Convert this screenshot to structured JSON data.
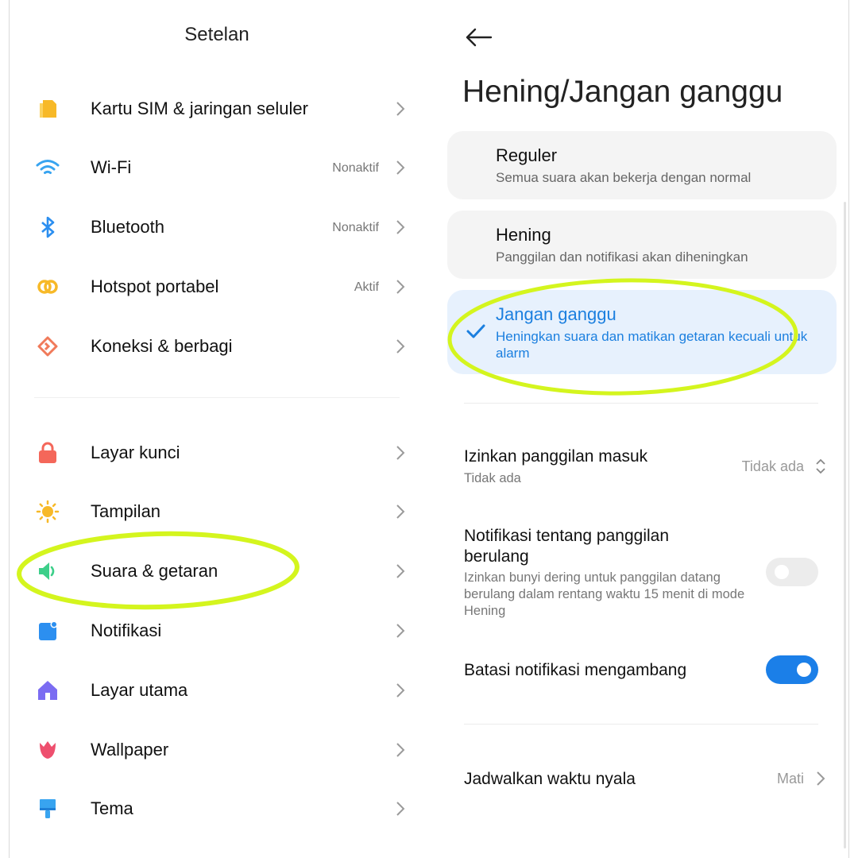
{
  "left": {
    "title": "Setelan",
    "items": [
      {
        "label": "Kartu SIM & jaringan seluler",
        "status": ""
      },
      {
        "label": "Wi-Fi",
        "status": "Nonaktif"
      },
      {
        "label": "Bluetooth",
        "status": "Nonaktif"
      },
      {
        "label": "Hotspot portabel",
        "status": "Aktif"
      },
      {
        "label": "Koneksi & berbagi",
        "status": ""
      },
      {
        "label": "Layar kunci",
        "status": ""
      },
      {
        "label": "Tampilan",
        "status": ""
      },
      {
        "label": "Suara & getaran",
        "status": ""
      },
      {
        "label": "Notifikasi",
        "status": ""
      },
      {
        "label": "Layar utama",
        "status": ""
      },
      {
        "label": "Wallpaper",
        "status": ""
      },
      {
        "label": "Tema",
        "status": ""
      }
    ],
    "icons": [
      "sim-card-icon",
      "wifi-icon",
      "bluetooth-icon",
      "hotspot-icon",
      "share-icon",
      "lock-icon",
      "brightness-icon",
      "speaker-icon",
      "notification-icon",
      "home-icon",
      "wallpaper-flower-icon",
      "theme-brush-icon"
    ]
  },
  "right": {
    "title": "Hening/Jangan ganggu",
    "modes": [
      {
        "title": "Reguler",
        "subtitle": "Semua suara akan bekerja dengan normal",
        "selected": false
      },
      {
        "title": "Hening",
        "subtitle": "Panggilan dan notifikasi akan diheningkan",
        "selected": false
      },
      {
        "title": "Jangan ganggu",
        "subtitle": "Heningkan suara dan matikan getaran kecuali untuk alarm",
        "selected": true
      }
    ],
    "allow_calls": {
      "title": "Izinkan panggilan masuk",
      "subtitle": "Tidak ada",
      "value": "Tidak ada"
    },
    "repeat_calls": {
      "title": "Notifikasi tentang panggilan berulang",
      "subtitle": "Izinkan bunyi dering untuk panggilan datang berulang dalam rentang waktu 15 menit di mode Hening",
      "enabled": false
    },
    "limit_floating": {
      "title": "Batasi notifikasi mengambang",
      "enabled": true
    },
    "schedule": {
      "title": "Jadwalkan waktu nyala",
      "value": "Mati"
    }
  },
  "colors": {
    "accent": "#1b7fe8",
    "highlight": "#d4f51e",
    "selected_card": "#e7f1fd",
    "card": "#f4f4f4"
  }
}
